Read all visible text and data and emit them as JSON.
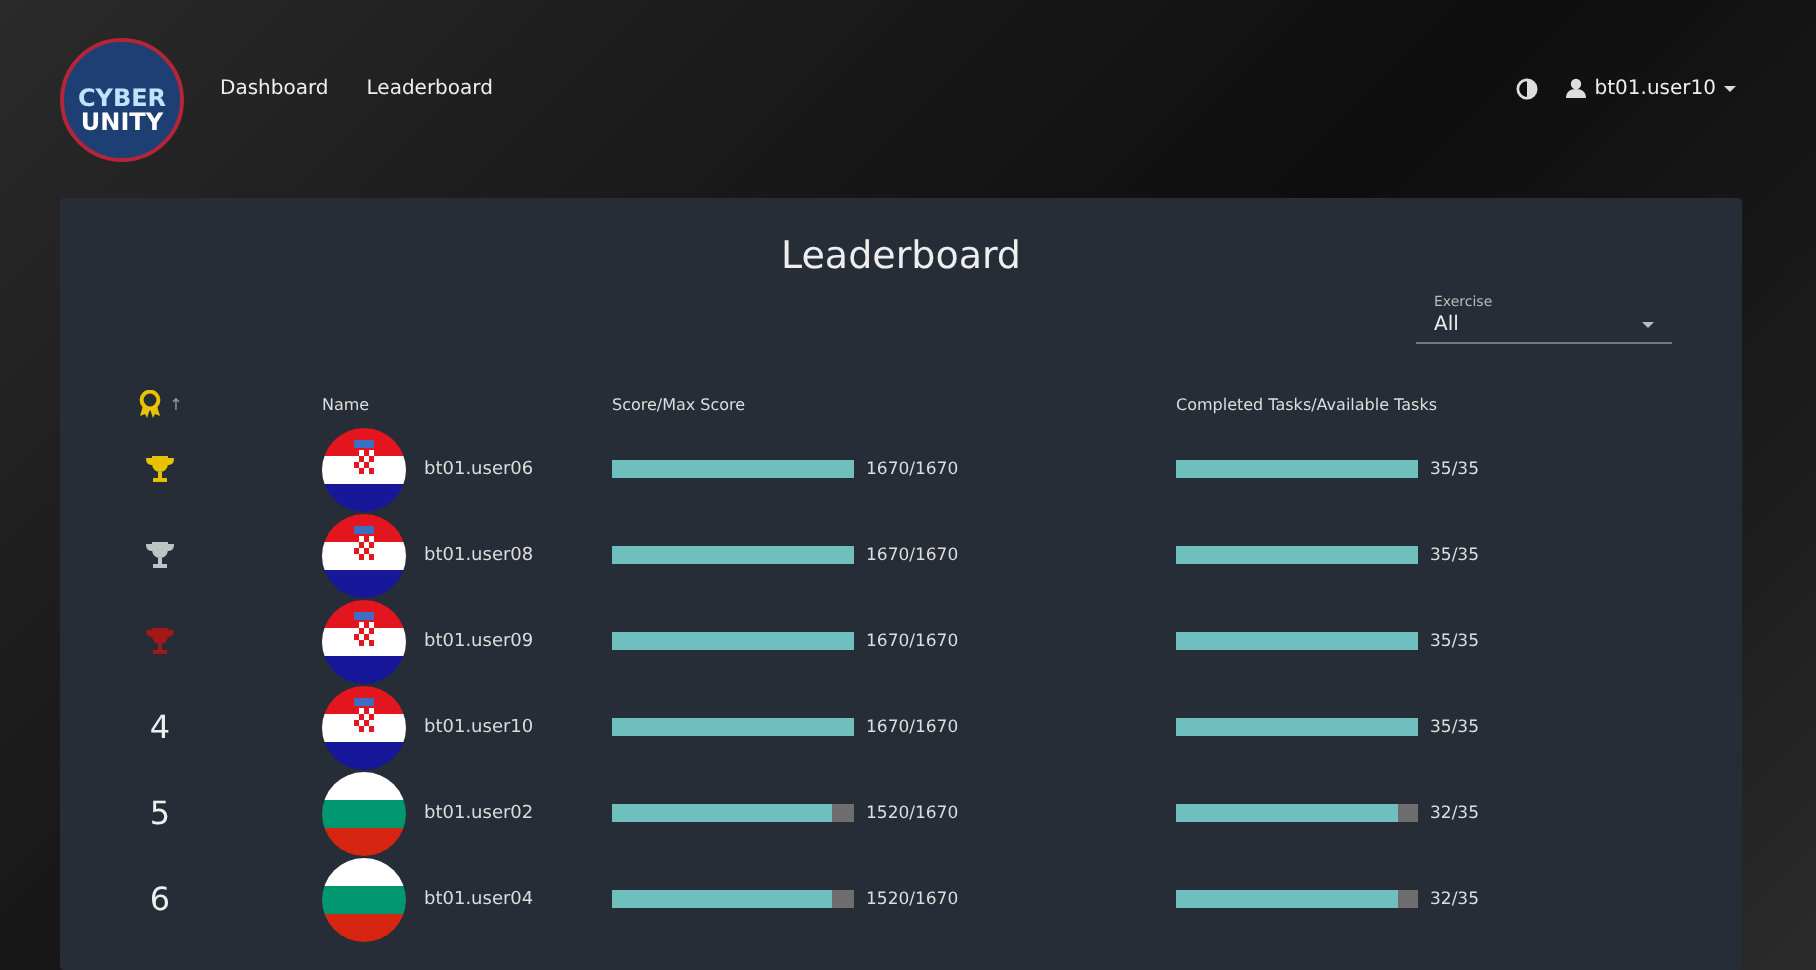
{
  "logo": {
    "line1": "CYBER",
    "line2": "UNITY"
  },
  "nav": [
    {
      "label": "Dashboard"
    },
    {
      "label": "Leaderboard"
    }
  ],
  "user": {
    "name": "bt01.user10"
  },
  "title": "Leaderboard",
  "exercise": {
    "label": "Exercise",
    "value": "All"
  },
  "columns": {
    "sort": "↑",
    "name": "Name",
    "score": "Score/Max Score",
    "tasks": "Completed Tasks/Available Tasks"
  },
  "rows": [
    {
      "kind": "gold",
      "flag": {
        "kind": "croatia"
      },
      "name": "bt01.user06",
      "score": "1670/1670",
      "score_level": {
        "level": 1
      },
      "tasks": "35/35",
      "tasks_level": {
        "level": 1
      }
    },
    {
      "kind": "silver",
      "flag": {
        "kind": "croatia"
      },
      "name": "bt01.user08",
      "score": "1670/1670",
      "score_level": {
        "level": 1
      },
      "tasks": "35/35",
      "tasks_level": {
        "level": 1
      }
    },
    {
      "kind": "bronze",
      "flag": {
        "kind": "croatia"
      },
      "name": "bt01.user09",
      "score": "1670/1670",
      "score_level": {
        "level": 1
      },
      "tasks": "35/35",
      "tasks_level": {
        "level": 1
      }
    },
    {
      "kind": "number",
      "rank": "4",
      "flag": {
        "kind": "croatia"
      },
      "name": "bt01.user10",
      "score": "1670/1670",
      "score_level": {
        "level": 1
      },
      "tasks": "35/35",
      "tasks_level": {
        "level": 1
      }
    },
    {
      "kind": "number",
      "rank": "5",
      "flag": {
        "kind": "bulgaria"
      },
      "name": "bt01.user02",
      "score": "1520/1670",
      "score_level": {
        "level": 0.91
      },
      "tasks": "32/35",
      "tasks_level": {
        "level": 0.914
      }
    },
    {
      "kind": "number",
      "rank": "6",
      "flag": {
        "kind": "bulgaria"
      },
      "name": "bt01.user04",
      "score": "1520/1670",
      "score_level": {
        "level": 0.91
      },
      "tasks": "32/35",
      "tasks_level": {
        "level": 0.914
      }
    }
  ]
}
